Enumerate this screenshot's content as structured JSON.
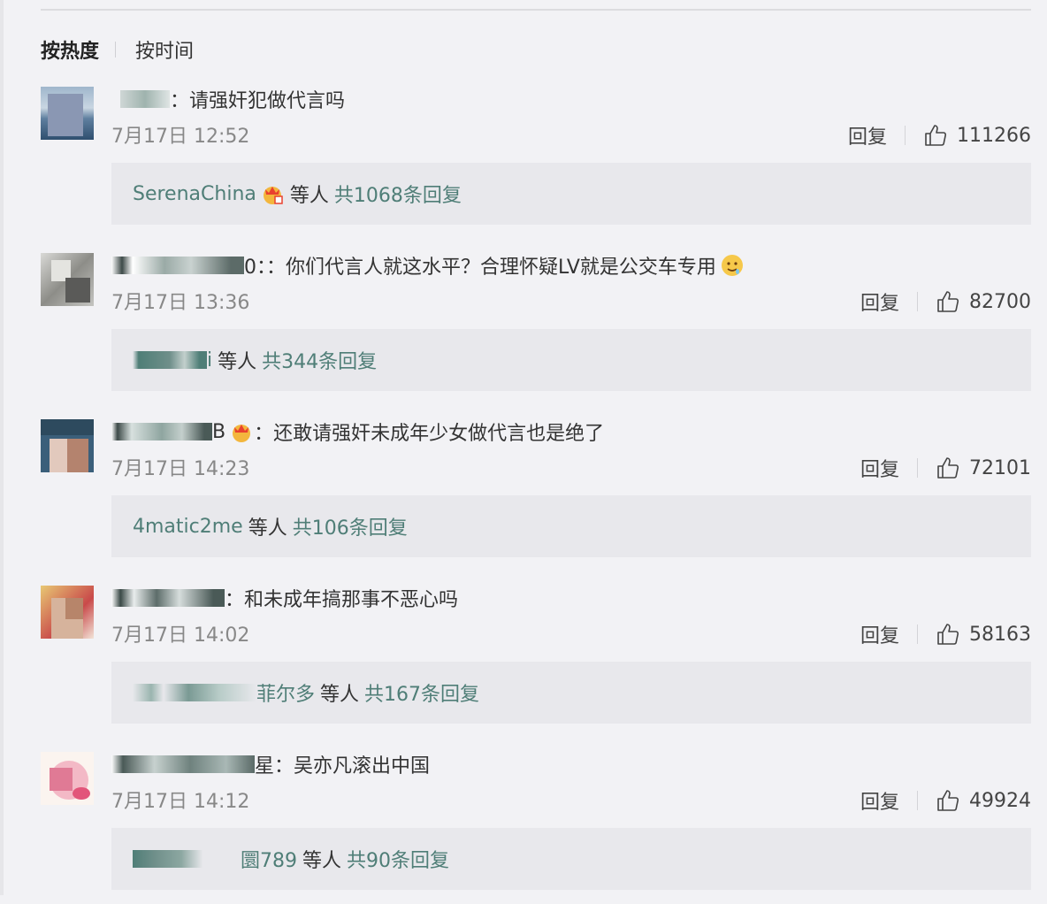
{
  "sort": {
    "hot": "按热度",
    "time": "按时间"
  },
  "reply_label": "回复",
  "comments": [
    {
      "user_suffix": "：",
      "text": "请强奸犯做代言吗",
      "time": "7月17日 12:52",
      "likes": "111266",
      "reply_user": "SerenaChina",
      "reply_etal": "等人",
      "reply_count": "共1068条回复"
    },
    {
      "user_suffix": "0：：",
      "text": "你们代言人就这水平？合理怀疑LV就是公交车专用",
      "time": "7月17日 13:36",
      "likes": "82700",
      "reply_user": "i",
      "reply_etal": "等人",
      "reply_count": "共344条回复"
    },
    {
      "user_suffix": "B",
      "user_tail": "：",
      "text": "还敢请强奸未成年少女做代言也是绝了",
      "time": "7月17日 14:23",
      "likes": "72101",
      "reply_user": "4matic2me",
      "reply_etal": "等人",
      "reply_count": "共106条回复"
    },
    {
      "user_suffix": "：",
      "text": "和未成年搞那事不恶心吗",
      "time": "7月17日 14:02",
      "likes": "58163",
      "reply_user": "菲尔多",
      "reply_etal": "等人",
      "reply_count": "共167条回复"
    },
    {
      "user_suffix": "星：",
      "text": "吴亦凡滚出中国",
      "time": "7月17日 14:12",
      "likes": "49924",
      "reply_user": "圜789",
      "reply_etal": "等人",
      "reply_count": "共90条回复"
    }
  ],
  "colors": {
    "link": "#4f7e77",
    "background": "#f2f2f5",
    "reply_box": "#e8e8ec"
  }
}
